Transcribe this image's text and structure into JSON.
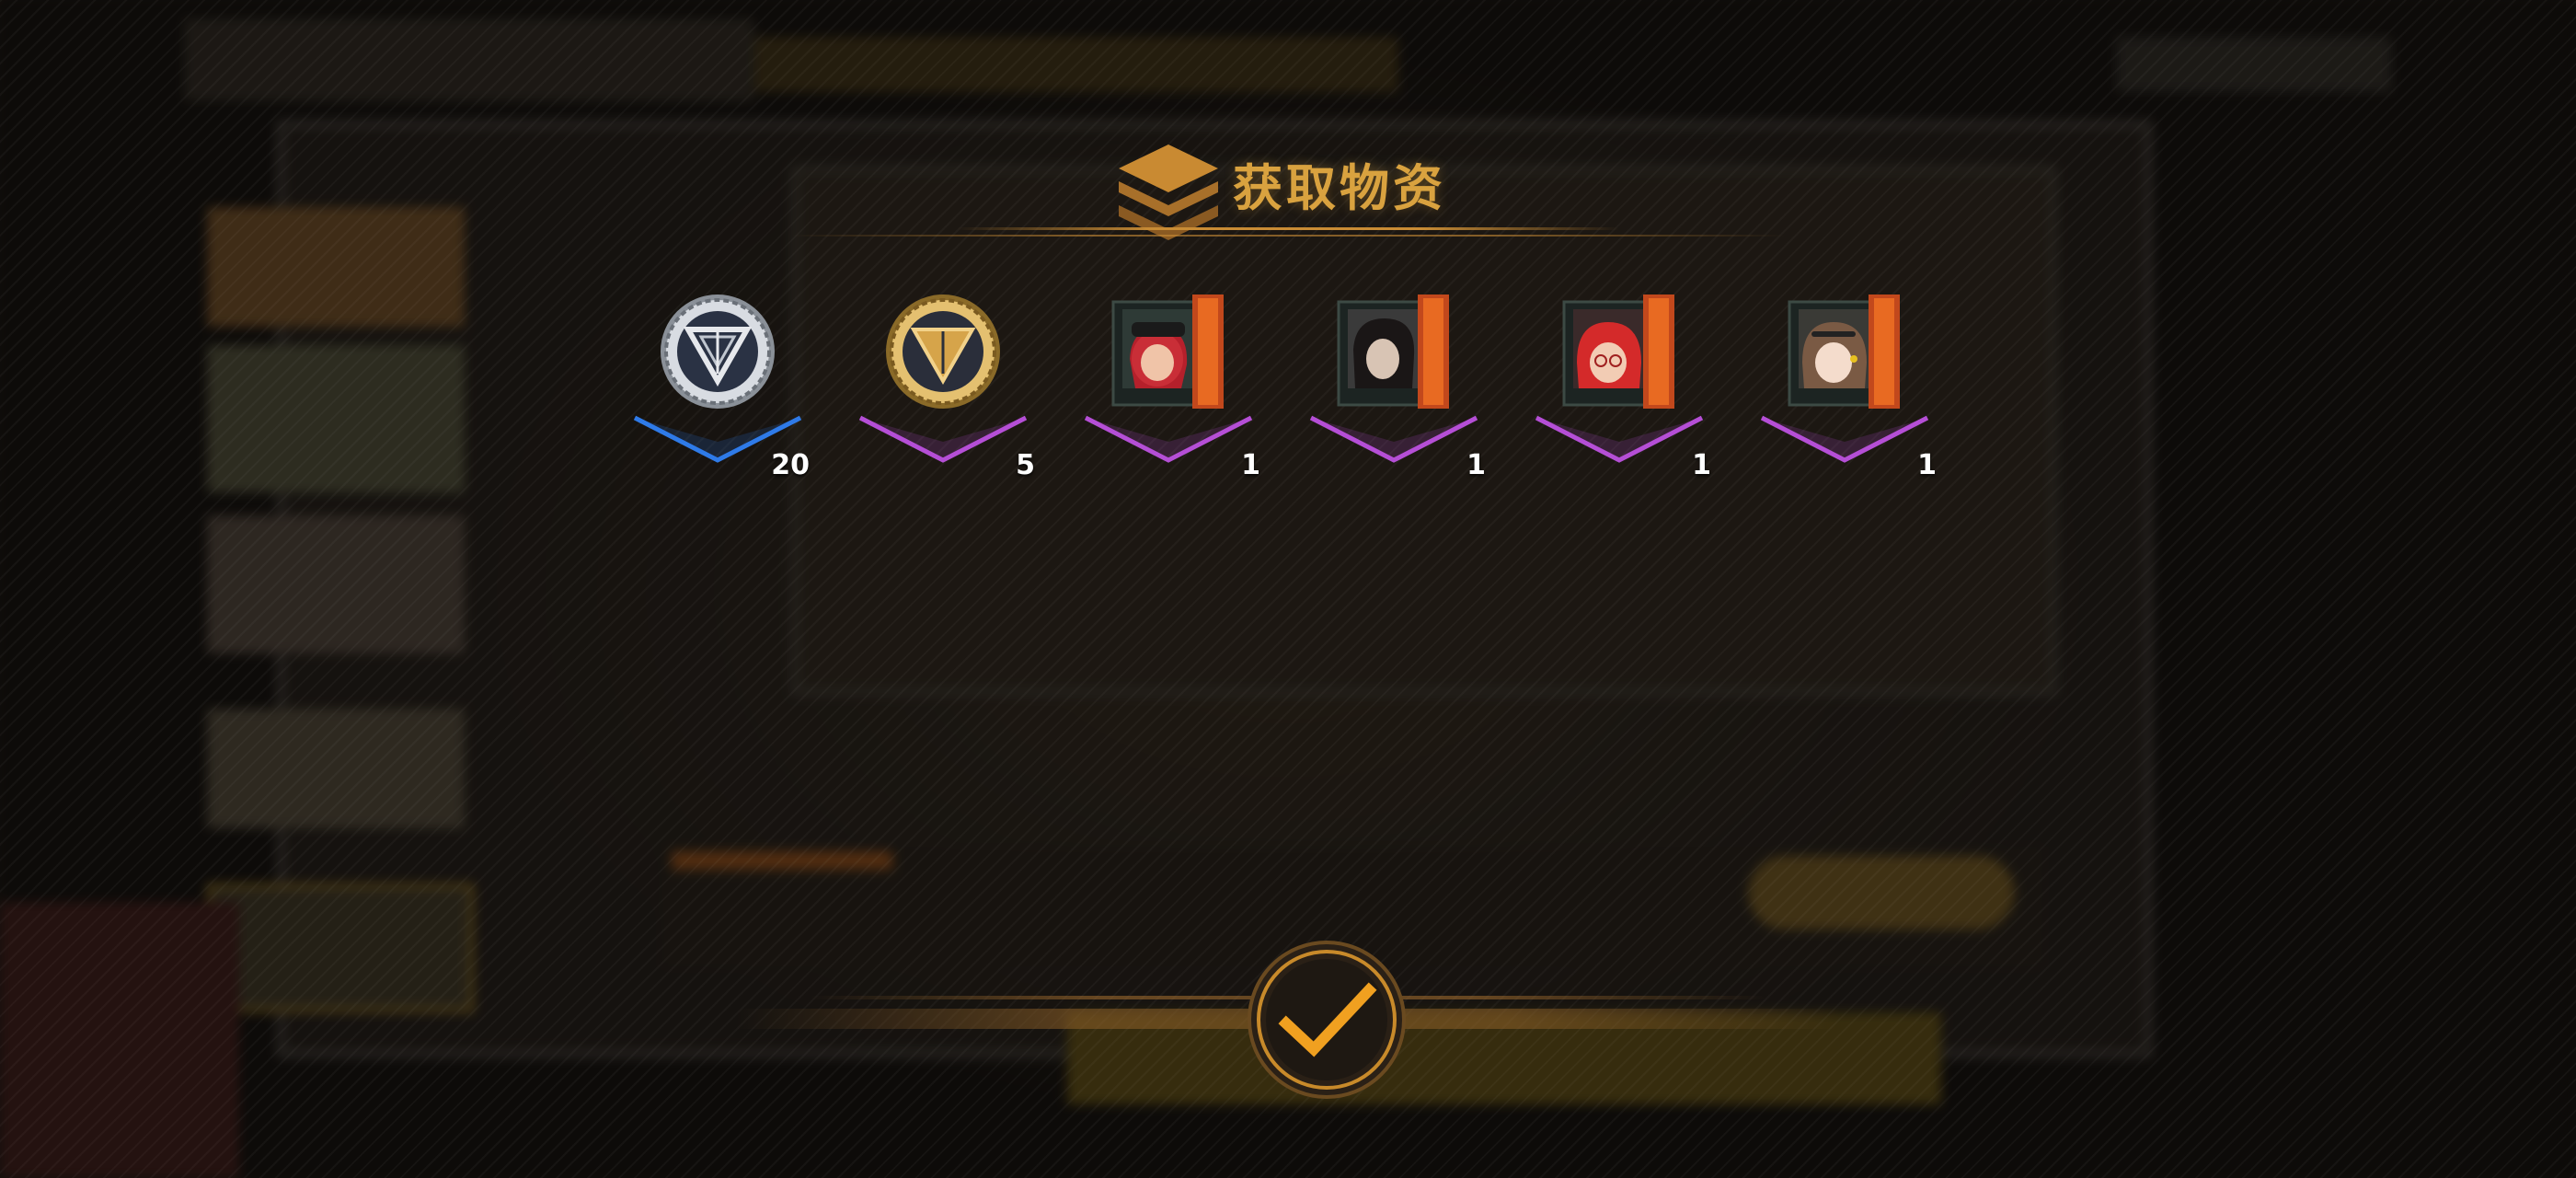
{
  "dialog": {
    "title": "获取物资",
    "confirm_icon": "checkmark-icon"
  },
  "rewards": [
    {
      "name": "silver-coin-icon",
      "quantity": "20",
      "rarity_color": "#2f7be8"
    },
    {
      "name": "gold-coin-icon",
      "quantity": "5",
      "rarity_color": "#b54fd6"
    },
    {
      "name": "character-card-red-hair-cap-icon",
      "quantity": "1",
      "rarity_color": "#b54fd6"
    },
    {
      "name": "character-card-dark-hair-icon",
      "quantity": "1",
      "rarity_color": "#b54fd6"
    },
    {
      "name": "character-card-red-hair-glasses-icon",
      "quantity": "1",
      "rarity_color": "#b54fd6"
    },
    {
      "name": "character-card-brown-hair-icon",
      "quantity": "1",
      "rarity_color": "#b54fd6"
    }
  ],
  "colors": {
    "title_gold": "#d9a23f",
    "accent_orange": "#f0a020",
    "rarity_blue": "#2f7be8",
    "rarity_purple": "#b54fd6"
  }
}
